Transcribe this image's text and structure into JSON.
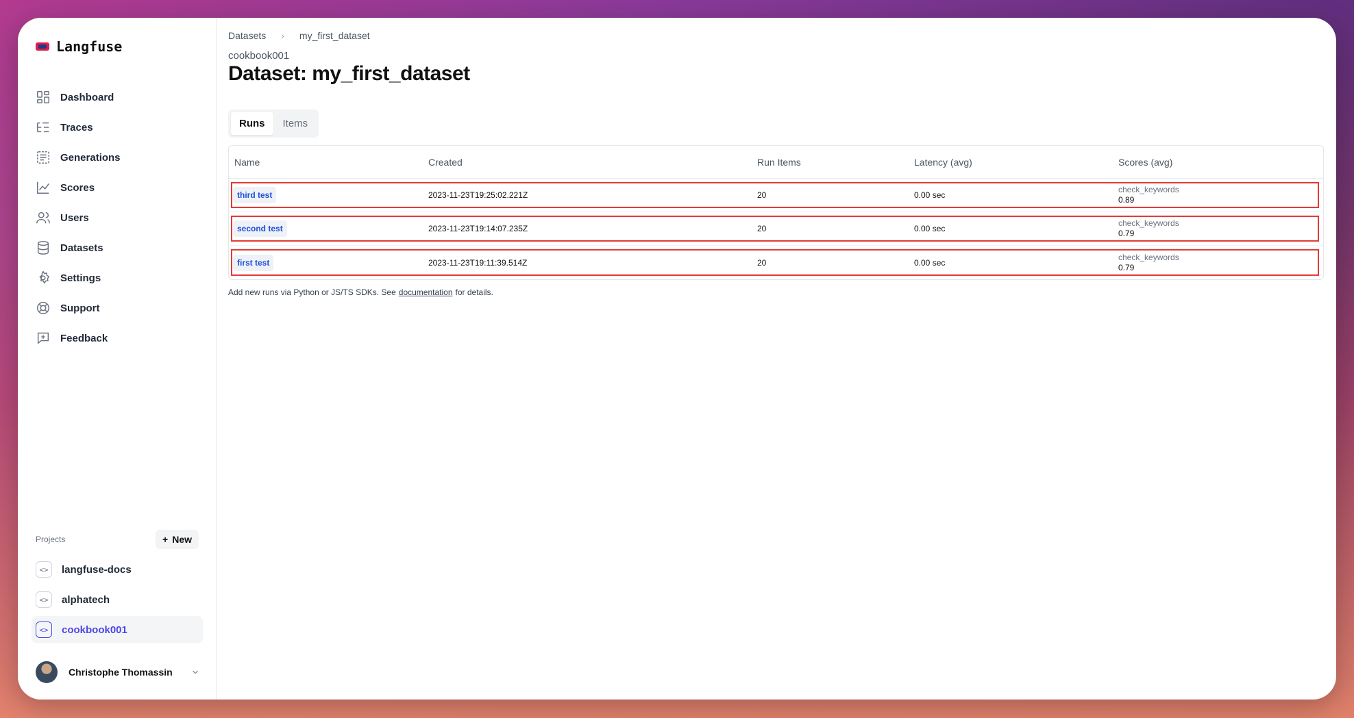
{
  "app": {
    "name": "Langfuse"
  },
  "sidebar": {
    "items": [
      {
        "label": "Dashboard",
        "icon": "dashboard-icon"
      },
      {
        "label": "Traces",
        "icon": "traces-icon"
      },
      {
        "label": "Generations",
        "icon": "generations-icon"
      },
      {
        "label": "Scores",
        "icon": "scores-icon"
      },
      {
        "label": "Users",
        "icon": "users-icon"
      },
      {
        "label": "Datasets",
        "icon": "datasets-icon"
      },
      {
        "label": "Settings",
        "icon": "settings-icon"
      },
      {
        "label": "Support",
        "icon": "support-icon"
      },
      {
        "label": "Feedback",
        "icon": "feedback-icon"
      }
    ],
    "projects_label": "Projects",
    "new_label": "New",
    "projects": [
      {
        "label": "langfuse-docs",
        "active": false
      },
      {
        "label": "alphatech",
        "active": false
      },
      {
        "label": "cookbook001",
        "active": true
      }
    ],
    "user": {
      "name": "Christophe Thomassin"
    }
  },
  "breadcrumb": {
    "parent": "Datasets",
    "current": "my_first_dataset"
  },
  "page": {
    "project": "cookbook001",
    "title": "Dataset: my_first_dataset"
  },
  "tabs": [
    {
      "label": "Runs",
      "active": true
    },
    {
      "label": "Items",
      "active": false
    }
  ],
  "table": {
    "headers": [
      "Name",
      "Created",
      "Run Items",
      "Latency (avg)",
      "Scores (avg)"
    ],
    "rows": [
      {
        "name": "third test",
        "created": "2023-11-23T19:25:02.221Z",
        "run_items": "20",
        "latency": "0.00 sec",
        "score_name": "check_keywords",
        "score_value": "0.89"
      },
      {
        "name": "second test",
        "created": "2023-11-23T19:14:07.235Z",
        "run_items": "20",
        "latency": "0.00 sec",
        "score_name": "check_keywords",
        "score_value": "0.79"
      },
      {
        "name": "first test",
        "created": "2023-11-23T19:11:39.514Z",
        "run_items": "20",
        "latency": "0.00 sec",
        "score_name": "check_keywords",
        "score_value": "0.79"
      }
    ]
  },
  "footnote": {
    "before": "Add new runs via Python or JS/TS SDKs. See",
    "link": "documentation",
    "after": "for details."
  },
  "colors": {
    "accent": "#4f46e5",
    "link": "#1d4ed8",
    "highlight": "#e53935"
  }
}
